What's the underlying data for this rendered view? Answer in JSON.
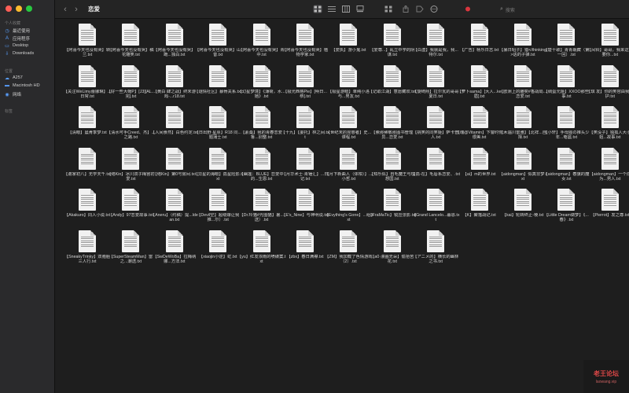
{
  "window": {
    "title": "恋爱"
  },
  "sidebar": {
    "sections": [
      {
        "label": "个人收藏",
        "items": [
          {
            "icon": "clock-icon",
            "label": "最近使用"
          },
          {
            "icon": "apps-icon",
            "label": "应用程序"
          },
          {
            "icon": "desktop-icon",
            "label": "Desktop"
          },
          {
            "icon": "download-icon",
            "label": "Downloads"
          }
        ]
      },
      {
        "label": "位置",
        "items": [
          {
            "icon": "cloud-icon",
            "label": "A257"
          },
          {
            "icon": "disk-icon",
            "label": "Macintosh HD"
          },
          {
            "icon": "network-icon",
            "label": "网络"
          }
        ]
      },
      {
        "label": "标签",
        "items": []
      }
    ]
  },
  "toolbar": {
    "back_icon": "chevron-left-icon",
    "forward_icon": "chevron-right-icon",
    "view_icons": [
      "icon-view-icon",
      "list-view-icon",
      "column-view-icon",
      "gallery-view-icon"
    ],
    "group_icon": "group-icon",
    "share_icon": "share-icon",
    "tag_icon": "tag-icon",
    "more_icon": "more-icon",
    "tag_color": "#d9363e",
    "search_placeholder": "搜索"
  },
  "files": [
    "【阿喜今天也没有哭】转兰.txt",
    "【阿喜今天也没有哭】稿花雕笑.txt",
    "【阿喜今天也没有哭】跪...独白.txt",
    "【阿喜今天也没有哭】山昔.txt",
    "【阿喜今天也没有哭】青中.txt",
    "【阿喜今天也没有哭】植物学家.txt",
    "【爱执】游小鬼.txt",
    "【爱尊...】乱立中学的阴谋.txt",
    "【白虚】我就是我，我...特尔.txt",
    "【广告】杨乐日志.txt",
    "【暴日昭子】猎</thinking>话的子弹.txt",
    "【楚十歌】青青栽藏（第一回）.txt",
    "【凤铃】哥哥，我来这里要你...txt",
    "【关注WeLimy蕾娜琳】...日常.txt",
    "【好一些大帽P】[J3][AL...完].txt",
    "【黄白 肆之战】终末游戏-...r18.txt",
    "【谜情社区】暴骨关系.txt",
    "【幻星梦境】《薄荷，水...她》.txt",
    "【极光西格Pie】[明日...恭].txt",
    "【极星游眼】单纯小洛与...男友.txt",
    "【记取江湖】意愿藏欢.txt",
    "【旋崎熙】拉尔瓦的哥哥夏日.txt",
    "【萝卜sama】[大人...ke眉].txt",
    "【欧洲上的雕奕#香战局...恋爱.txt",
    "【绸蛋元姬】XXOO那些事.txt",
    "【琪 发】你的笑容由我守护.txt",
    "【清眼】晨肯季梦.txt",
    "【清水可手Creed、杰】...之路.txt",
    "【人间食然】白色约定.txt",
    "【日出野 星原】R18 同...题蒲士.txt",
    "【素桑】我的青春恋爱鲁...别整.txt",
    "【十九】【委托】林之间.txt",
    "【世纪末的昆慈者】史...课程.txt",
    "【索那稀敬那图书管理员...恋爱.txt",
    "【挑笑的同笑姬】萨卡普人.txt",
    "【魂@Vitamin】下警时你很美.txt",
    "【木遇川雷雅】【北祥...自择.txt",
    "【小轩】手母圈の推头少年...奄晨.txt",
    "【笑没子】独孤人大小姐...故事.txt",
    "【谢家初八】无学天千.txt",
    "【络Kin】冰川双子梅宫初爱.txt",
    "【络Kin】第0号房间.txt",
    "【异星的海眼】孤星险影.txt",
    "【幽莲：BLUE】恋爱中的...生恩.txt",
    "【月华术士·青锤汇】...日记.txt",
    "【月下新曲人（体柑）】...小哲.txt",
    "【知乐似】自毛魔王与理想国.txt",
    "【孤-在】毛唇系恋爱、.txt",
    "【ai】m的世界.txt",
    "【aidongman】似真非梦.txt",
    "【aidongman】春旗的魔女.txt",
    "【aidongman】一个成为...男人.txt",
    "【Akakuro】同人小说.txt",
    "【Andy】97恋爱故事.txt",
    "【Aneru】（约稿）提...ldean.txt",
    "【Devil空】超级爆让我推...尔）.txt",
    "【Dr.玲猫#光圈猫】暑...送）.txt",
    "【E's_Nine】与神明说.txt",
    "【Evything's Gone】...组.txt",
    "【FraMaTic】锐应张影.txt",
    "【Grand Lancelo...暮恩.txt",
    "【K】聚落战记.txt",
    "【kai】轮转终止-棱.txt",
    "【Little Dream做梦】《...春》.txt",
    "【Pierrot】发之尊.txt",
    "【SneakyTrinky】双胞胎三人行.txt",
    "【SuperSteamMan】雷之...潮透.txt",
    "【SwDeWoBa】拉梅纳娜...方法.txt",
    "【xiaojin小逆】虹.txt",
    "【yu】红发浓雨的喷碟案.txt",
    "【zbx】春日满襟.txt",
    "【ZM】我加载了色情游戏（2）.txt",
    "【a0·漫画无朵】偷拾苦花.txt",
    "【アニメ的】横长的幽林之书.txt"
  ],
  "watermark": {
    "title": "老王论坛",
    "subtitle": "laowang.vip"
  }
}
